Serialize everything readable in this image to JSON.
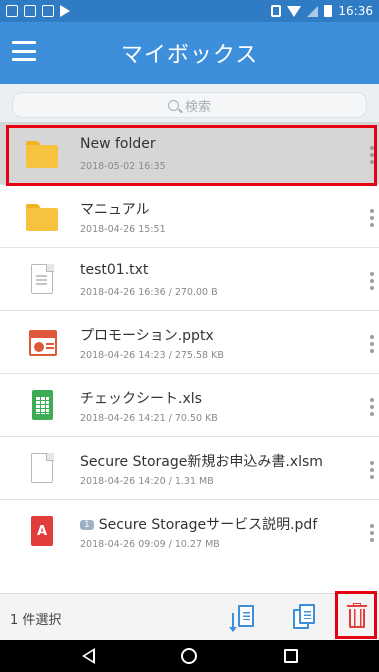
{
  "status_bar": {
    "time": "16:36"
  },
  "app_bar": {
    "title": "マイボックス"
  },
  "search": {
    "placeholder": "検索"
  },
  "files": [
    {
      "name": "New folder",
      "meta": "2018-05-02 16:35",
      "type": "folder",
      "selected": true
    },
    {
      "name": "マニュアル",
      "meta": "2018-04-26 15:51",
      "type": "folder",
      "selected": false
    },
    {
      "name": "test01.txt",
      "meta": "2018-04-26 16:36 / 270.00 B",
      "type": "txt",
      "selected": false
    },
    {
      "name": "プロモーション.pptx",
      "meta": "2018-04-26 14:23 / 275.58 KB",
      "type": "pptx",
      "selected": false
    },
    {
      "name": "チェックシート.xls",
      "meta": "2018-04-26 14:21 / 70.50 KB",
      "type": "xls",
      "selected": false
    },
    {
      "name": "Secure Storage新規お申込み書.xlsm",
      "meta": "2018-04-26 14:20 / 1.31 MB",
      "type": "doc",
      "selected": false
    },
    {
      "name": "Secure Storageサービス説明.pdf",
      "meta": "2018-04-26 09:09 / 10.27 MB",
      "type": "pdf",
      "badge": "1",
      "selected": false
    }
  ],
  "bottom_bar": {
    "selection_count": "1 件選択"
  },
  "colors": {
    "app_bar": "#3d8fdb",
    "status_bar": "#2f7bc4",
    "highlight": "#e60012",
    "folder": "#f7c23d",
    "delete": "#e23d3d"
  },
  "icons": [
    "menu-icon",
    "search-icon",
    "folder-icon",
    "text-file-icon",
    "pptx-file-icon",
    "xls-file-icon",
    "file-icon",
    "pdf-file-icon",
    "more-vert-icon",
    "move-icon",
    "copy-icon",
    "trash-icon",
    "nav-back-icon",
    "nav-home-icon",
    "nav-recent-icon"
  ]
}
